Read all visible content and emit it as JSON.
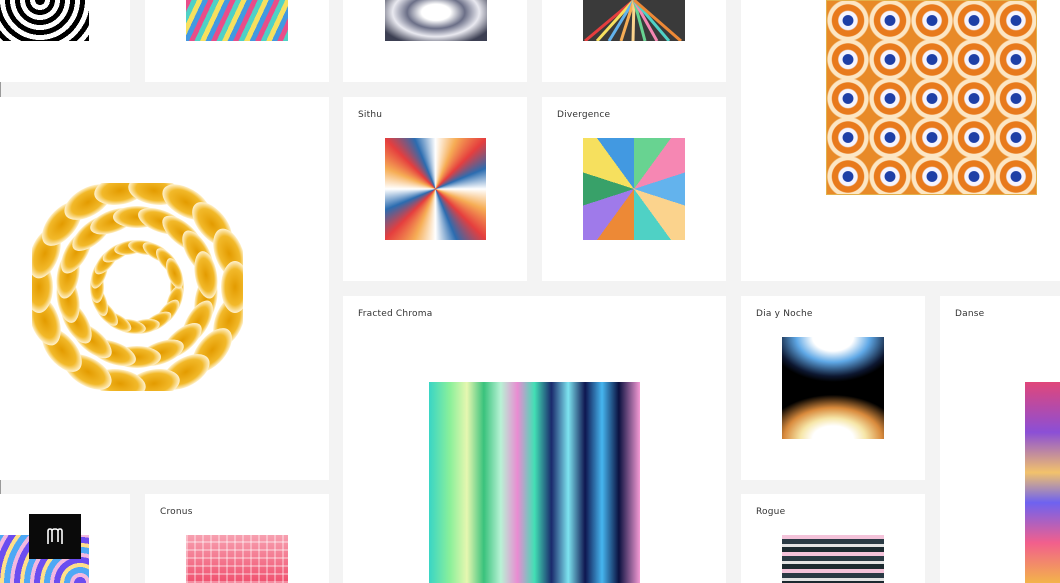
{
  "gallery": {
    "titles": {
      "sithu": "Sithu",
      "divergence": "Divergence",
      "fracted_chroma": "Fracted Chroma",
      "dia_y_noche": "Dia y Noche",
      "danse": "Danse",
      "cronus": "Cronus",
      "rogue": "Rogue"
    }
  },
  "logo": {
    "icon": "brand-logo-icon"
  }
}
